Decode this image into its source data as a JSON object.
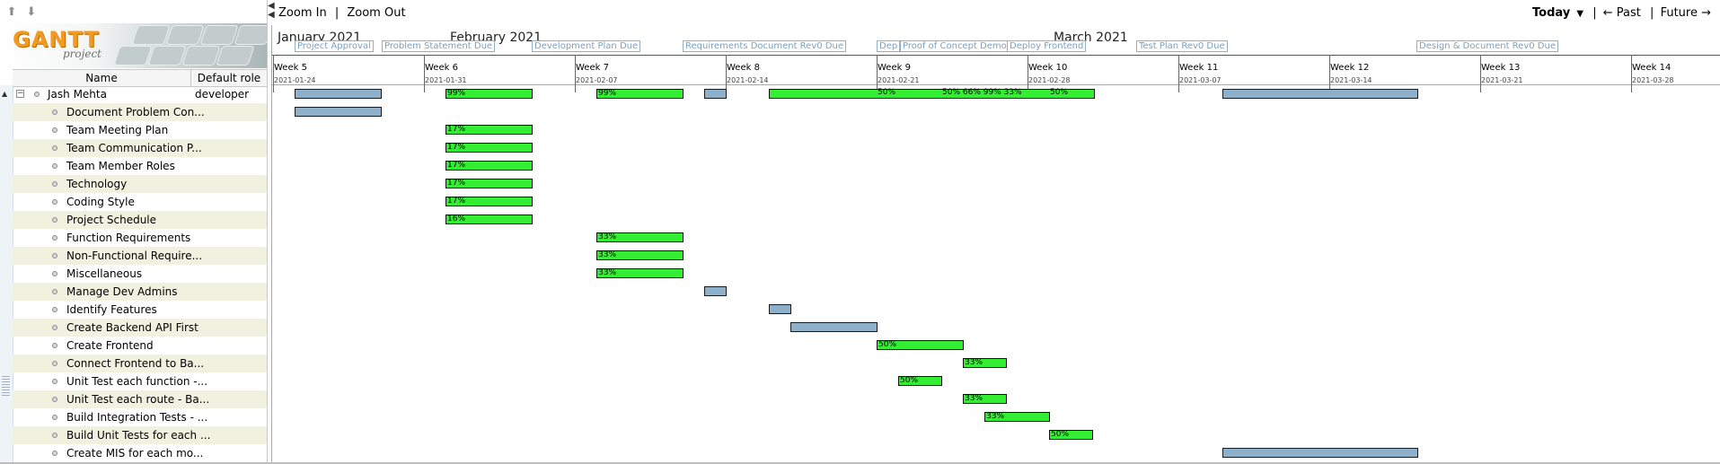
{
  "app": {
    "logo_text": "GANTT",
    "logo_sub": "project"
  },
  "columns": {
    "name": "Name",
    "role": "Default role"
  },
  "toolbar": {
    "zoom_in": "Zoom In",
    "separator": "|",
    "zoom_out": "Zoom Out",
    "today": "Today",
    "today_caret": "▼",
    "past": "← Past",
    "future": "Future →"
  },
  "months": [
    "January 2021",
    "February 2021",
    "March 2021"
  ],
  "milestones": [
    "Project Approval",
    "Problem Statement Due",
    "Development Plan Due",
    "Requirements Document Rev0 Due",
    "Dep",
    "Proof of Concept Demo",
    "Deploy Frontend",
    "Test Plan Rev0 Due",
    "Design & Document Rev0 Due"
  ],
  "weeks": [
    {
      "label": "Week 5",
      "date": "2021-01-24"
    },
    {
      "label": "Week 6",
      "date": "2021-01-31"
    },
    {
      "label": "Week 7",
      "date": "2021-02-07"
    },
    {
      "label": "Week 8",
      "date": "2021-02-14"
    },
    {
      "label": "Week 9",
      "date": "2021-02-21"
    },
    {
      "label": "Week 10",
      "date": "2021-02-28"
    },
    {
      "label": "Week 11",
      "date": "2021-03-07"
    },
    {
      "label": "Week 12",
      "date": "2021-03-14"
    },
    {
      "label": "Week 13",
      "date": "2021-03-21"
    },
    {
      "label": "Week 14",
      "date": "2021-03-28"
    }
  ],
  "tasks": [
    {
      "name": "Jash Mehta",
      "role": "developer",
      "parent": true
    },
    {
      "name": "Document Problem Con..."
    },
    {
      "name": "Team Meeting Plan"
    },
    {
      "name": "Team Communication P..."
    },
    {
      "name": "Team Member Roles"
    },
    {
      "name": "Technology"
    },
    {
      "name": "Coding Style"
    },
    {
      "name": "Project Schedule"
    },
    {
      "name": "Function Requirements"
    },
    {
      "name": "Non-Functional Require..."
    },
    {
      "name": "Miscellaneous"
    },
    {
      "name": "Manage Dev Admins"
    },
    {
      "name": "Identify Features"
    },
    {
      "name": "Create Backend API First"
    },
    {
      "name": "Create Frontend"
    },
    {
      "name": "Connect Frontend to Ba..."
    },
    {
      "name": "Unit Test each function -..."
    },
    {
      "name": "Unit Test each route - Ba..."
    },
    {
      "name": "Build Integration Tests - ..."
    },
    {
      "name": "Build Unit Tests for each ..."
    },
    {
      "name": "Create MIS for each mo..."
    }
  ],
  "bar_labels": {
    "r0": [
      "99%",
      "99%",
      "50%",
      "50% 66% 99% 33%",
      "50%"
    ],
    "r2": "17%",
    "r3": "17%",
    "r4": "17%",
    "r5": "17%",
    "r6": "17%",
    "r7": "16%",
    "r8": "33%",
    "r9": "33%",
    "r10": "33%",
    "r14": "50%",
    "r15": "33%",
    "r16": "50%",
    "r17": "33%",
    "r18": "33%",
    "r19": "50%"
  },
  "colors": {
    "task_bar": "#8fb0cb",
    "progress_bar": "#33ee33",
    "milestone_text": "#7a9fbe",
    "row_alt": "#f1f1e0",
    "logo_orange": "#f39a21"
  }
}
